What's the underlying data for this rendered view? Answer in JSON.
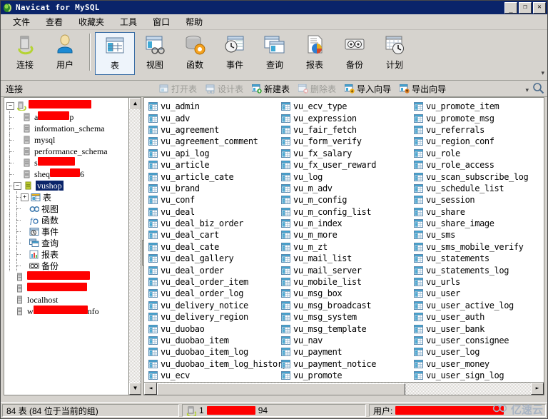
{
  "window": {
    "title": "Navicat for MySQL",
    "app_icon": "navicat-icon",
    "minimize": "_",
    "maximize": "❐",
    "close": "✕"
  },
  "menubar": {
    "items": [
      {
        "label": "文件",
        "name": "menu-file"
      },
      {
        "label": "查看",
        "name": "menu-view"
      },
      {
        "label": "收藏夹",
        "name": "menu-favorites"
      },
      {
        "label": "工具",
        "name": "menu-tools"
      },
      {
        "label": "窗口",
        "name": "menu-window"
      },
      {
        "label": "帮助",
        "name": "menu-help"
      }
    ]
  },
  "toolbar": {
    "buttons": [
      {
        "label": "连接",
        "icon": "connection-icon",
        "selected": false
      },
      {
        "label": "用户",
        "icon": "user-icon",
        "selected": false
      },
      {
        "label": "表",
        "icon": "table-icon",
        "selected": true
      },
      {
        "label": "视图",
        "icon": "view-icon",
        "selected": false
      },
      {
        "label": "函数",
        "icon": "function-icon",
        "selected": false
      },
      {
        "label": "事件",
        "icon": "event-icon",
        "selected": false
      },
      {
        "label": "查询",
        "icon": "query-icon",
        "selected": false
      },
      {
        "label": "报表",
        "icon": "report-icon",
        "selected": false
      },
      {
        "label": "备份",
        "icon": "backup-icon",
        "selected": false
      },
      {
        "label": "计划",
        "icon": "schedule-icon",
        "selected": false
      }
    ],
    "overflow": "▾"
  },
  "subtoolbar": {
    "connection_header": "连接",
    "buttons": [
      {
        "label": "打开表",
        "icon": "open-table-icon",
        "disabled": true
      },
      {
        "label": "设计表",
        "icon": "design-table-icon",
        "disabled": true
      },
      {
        "label": "新建表",
        "icon": "new-table-icon",
        "disabled": false
      },
      {
        "label": "删除表",
        "icon": "delete-table-icon",
        "disabled": true
      },
      {
        "label": "导入向导",
        "icon": "import-wizard-icon",
        "disabled": false
      },
      {
        "label": "导出向导",
        "icon": "export-wizard-icon",
        "disabled": false
      }
    ],
    "overflow": "▾",
    "search_icon": "search-icon"
  },
  "tree": {
    "nodes": [
      {
        "label": "",
        "redacted": true,
        "redact_width": 88,
        "indent": 0,
        "expander": "−",
        "icon": "server-connection-icon",
        "selected": false
      },
      {
        "label": "a",
        "redacted": true,
        "redact_width": 44,
        "suffix": "p",
        "indent": 1,
        "expander": "",
        "icon": "database-icon",
        "selected": false
      },
      {
        "label": "information_schema",
        "redacted": false,
        "indent": 1,
        "expander": "",
        "icon": "database-icon",
        "selected": false
      },
      {
        "label": "mysql",
        "redacted": false,
        "indent": 1,
        "expander": "",
        "icon": "database-icon",
        "selected": false
      },
      {
        "label": "performance_schema",
        "redacted": false,
        "indent": 1,
        "expander": "",
        "icon": "database-icon",
        "selected": false
      },
      {
        "label": "s",
        "redacted": true,
        "redact_width": 52,
        "indent": 1,
        "expander": "",
        "icon": "database-icon",
        "selected": false
      },
      {
        "label": "sheq",
        "redacted": true,
        "redact_width": 42,
        "suffix": "6",
        "indent": 1,
        "expander": "",
        "icon": "database-icon",
        "selected": false
      },
      {
        "label": "vushop",
        "redacted": false,
        "indent": 1,
        "expander": "−",
        "icon": "database-open-icon",
        "selected": true
      },
      {
        "label": "表",
        "redacted": false,
        "indent": 2,
        "expander": "+",
        "icon": "tables-folder-icon",
        "selected": false
      },
      {
        "label": "视图",
        "redacted": false,
        "indent": 2,
        "expander": "",
        "icon": "views-folder-icon",
        "selected": false
      },
      {
        "label": "函数",
        "redacted": false,
        "indent": 2,
        "expander": "",
        "icon": "functions-folder-icon",
        "selected": false
      },
      {
        "label": "事件",
        "redacted": false,
        "indent": 2,
        "expander": "",
        "icon": "events-folder-icon",
        "selected": false
      },
      {
        "label": "查询",
        "redacted": false,
        "indent": 2,
        "expander": "",
        "icon": "queries-folder-icon",
        "selected": false
      },
      {
        "label": "报表",
        "redacted": false,
        "indent": 2,
        "expander": "",
        "icon": "reports-folder-icon",
        "selected": false
      },
      {
        "label": "备份",
        "redacted": false,
        "indent": 2,
        "expander": "",
        "icon": "backups-folder-icon",
        "selected": false
      },
      {
        "label": "",
        "redacted": true,
        "redact_width": 88,
        "indent": 0,
        "expander": "",
        "icon": "connection-icon",
        "selected": false
      },
      {
        "label": "",
        "redacted": true,
        "redact_width": 84,
        "indent": 0,
        "expander": "",
        "icon": "connection-icon",
        "selected": false
      },
      {
        "label": "localhost",
        "redacted": false,
        "indent": 0,
        "expander": "",
        "icon": "connection-icon",
        "selected": false
      },
      {
        "label": "w",
        "redacted": true,
        "redact_width": 76,
        "suffix": "nfo",
        "indent": 0,
        "expander": "",
        "icon": "connection-icon",
        "selected": false
      }
    ]
  },
  "table_list": {
    "item_icon": "table-item-icon",
    "columns": [
      [
        "vu_admin",
        "vu_adv",
        "vu_agreement",
        "vu_agreement_comment",
        "vu_api_log",
        "vu_article",
        "vu_article_cate",
        "vu_brand",
        "vu_conf",
        "vu_deal",
        "vu_deal_biz_order",
        "vu_deal_cart",
        "vu_deal_cate",
        "vu_deal_gallery",
        "vu_deal_order",
        "vu_deal_order_item",
        "vu_deal_order_log",
        "vu_delivery_notice",
        "vu_delivery_region",
        "vu_duobao",
        "vu_duobao_item",
        "vu_duobao_item_log",
        "vu_duobao_item_log_history",
        "vu_ecv"
      ],
      [
        "vu_ecv_type",
        "vu_expression",
        "vu_fair_fetch",
        "vu_form_verify",
        "vu_fx_salary",
        "vu_fx_user_reward",
        "vu_log",
        "vu_m_adv",
        "vu_m_config",
        "vu_m_config_list",
        "vu_m_index",
        "vu_m_more",
        "vu_m_zt",
        "vu_mail_list",
        "vu_mail_server",
        "vu_mobile_list",
        "vu_msg_box",
        "vu_msg_broadcast",
        "vu_msg_system",
        "vu_msg_template",
        "vu_nav",
        "vu_payment",
        "vu_payment_notice",
        "vu_promote"
      ],
      [
        "vu_promote_item",
        "vu_promote_msg",
        "vu_referrals",
        "vu_region_conf",
        "vu_role",
        "vu_role_access",
        "vu_scan_subscribe_log",
        "vu_schedule_list",
        "vu_session",
        "vu_share",
        "vu_share_image",
        "vu_sms",
        "vu_sms_mobile_verify",
        "vu_statements",
        "vu_statements_log",
        "vu_urls",
        "vu_user",
        "vu_user_active_log",
        "vu_user_auth",
        "vu_user_bank",
        "vu_user_consignee",
        "vu_user_log",
        "vu_user_money",
        "vu_user_sign_log"
      ]
    ],
    "scroll_left_arrow": "◄",
    "scroll_right_arrow": "►"
  },
  "statusbar": {
    "count_text": "84 表  (84 位于当前的组)",
    "server_icon": "server-icon",
    "server_prefix": "1",
    "server_suffix": "94",
    "server_redact_width": 68,
    "user_label": "用户:",
    "user_redact_width": 152
  },
  "watermark": {
    "text": "亿速云",
    "icon": "cloud-logo-icon"
  },
  "colors": {
    "titlebar": "#0a246a",
    "chrome": "#d6d3ce",
    "selection": "#0a246a",
    "redaction": "#fe0000",
    "table_icon_blue": "#3fa9d5",
    "watermark": "#a8b4c4"
  }
}
